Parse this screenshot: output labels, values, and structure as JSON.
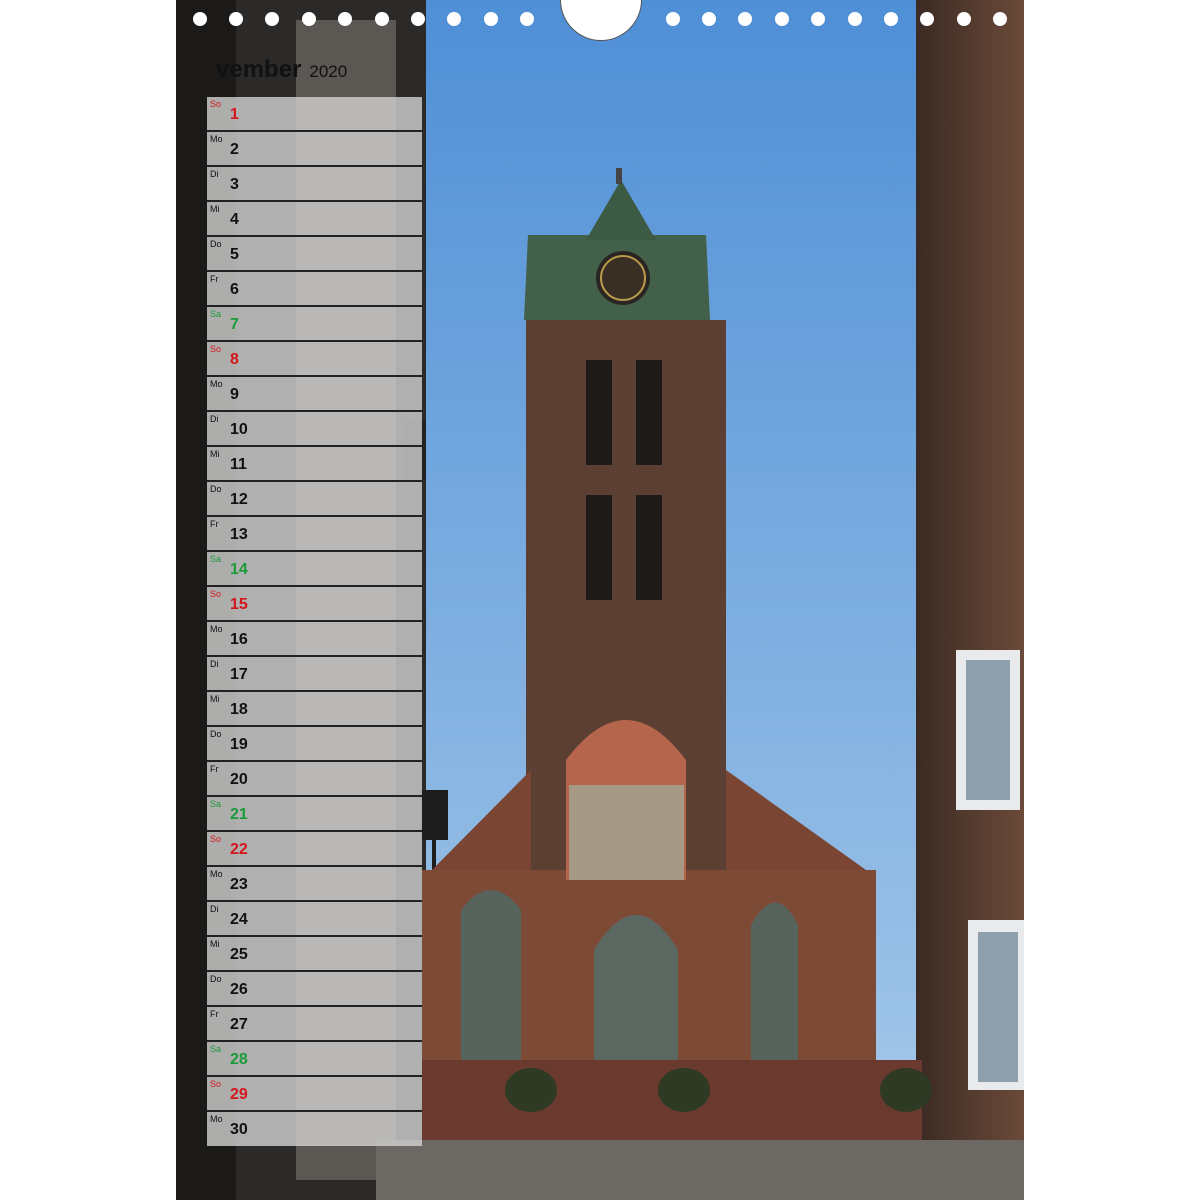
{
  "calendar": {
    "month": "vember",
    "year": "2020",
    "days": [
      {
        "wd": "So",
        "n": "1",
        "kind": "sun"
      },
      {
        "wd": "Mo",
        "n": "2",
        "kind": ""
      },
      {
        "wd": "Di",
        "n": "3",
        "kind": ""
      },
      {
        "wd": "Mi",
        "n": "4",
        "kind": ""
      },
      {
        "wd": "Do",
        "n": "5",
        "kind": ""
      },
      {
        "wd": "Fr",
        "n": "6",
        "kind": ""
      },
      {
        "wd": "Sa",
        "n": "7",
        "kind": "sat"
      },
      {
        "wd": "So",
        "n": "8",
        "kind": "sun"
      },
      {
        "wd": "Mo",
        "n": "9",
        "kind": ""
      },
      {
        "wd": "Di",
        "n": "10",
        "kind": ""
      },
      {
        "wd": "Mi",
        "n": "11",
        "kind": ""
      },
      {
        "wd": "Do",
        "n": "12",
        "kind": ""
      },
      {
        "wd": "Fr",
        "n": "13",
        "kind": ""
      },
      {
        "wd": "Sa",
        "n": "14",
        "kind": "sat"
      },
      {
        "wd": "So",
        "n": "15",
        "kind": "sun"
      },
      {
        "wd": "Mo",
        "n": "16",
        "kind": ""
      },
      {
        "wd": "Di",
        "n": "17",
        "kind": ""
      },
      {
        "wd": "Mi",
        "n": "18",
        "kind": ""
      },
      {
        "wd": "Do",
        "n": "19",
        "kind": ""
      },
      {
        "wd": "Fr",
        "n": "20",
        "kind": ""
      },
      {
        "wd": "Sa",
        "n": "21",
        "kind": "sat"
      },
      {
        "wd": "So",
        "n": "22",
        "kind": "sun"
      },
      {
        "wd": "Mo",
        "n": "23",
        "kind": ""
      },
      {
        "wd": "Di",
        "n": "24",
        "kind": ""
      },
      {
        "wd": "Mi",
        "n": "25",
        "kind": ""
      },
      {
        "wd": "Do",
        "n": "26",
        "kind": ""
      },
      {
        "wd": "Fr",
        "n": "27",
        "kind": ""
      },
      {
        "wd": "Sa",
        "n": "28",
        "kind": "sat"
      },
      {
        "wd": "So",
        "n": "29",
        "kind": "sun"
      },
      {
        "wd": "Mo",
        "n": "30",
        "kind": ""
      }
    ]
  },
  "colors": {
    "sunday": "#d4161b",
    "saturday": "#1a9a3a",
    "sky": "#6ea3dc",
    "brick": "#8a4a35"
  },
  "icons": {
    "binding": "spiral-binding-hole",
    "hanger": "wall-hanger-cutout"
  }
}
